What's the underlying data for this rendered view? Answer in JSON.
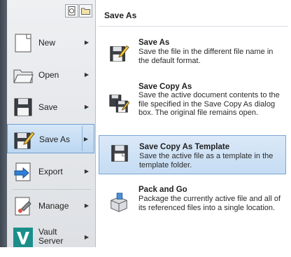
{
  "left_menu": {
    "items": [
      {
        "label": "New",
        "icon": "new-document-icon"
      },
      {
        "label": "Open",
        "icon": "folder-open-icon"
      },
      {
        "label": "Save",
        "icon": "floppy-disk-icon"
      },
      {
        "label": "Save As",
        "icon": "save-as-icon"
      },
      {
        "label": "Export",
        "icon": "export-icon"
      },
      {
        "label": "Manage",
        "icon": "manage-icon"
      },
      {
        "label_line1": "Vault",
        "label_line2": "Server",
        "icon": "vault-logo-icon"
      }
    ]
  },
  "submenu": {
    "title": "Save As",
    "items": [
      {
        "title": "Save As",
        "description": "Save the file in the different file name in the default format."
      },
      {
        "title": "Save Copy As",
        "description": "Save the active document contents to the file specified in the Save Copy As dialog box. The original file remains open."
      },
      {
        "title": "Save Copy As Template",
        "description": "Save the active file as a template in the template folder."
      },
      {
        "title": "Pack and Go",
        "description": "Package the currently active file and all of its referenced files into a single location."
      }
    ]
  },
  "colors": {
    "accent": "#c5dcf3",
    "accent_border": "#6f9fd0",
    "vault_green": "#27a6a0"
  }
}
